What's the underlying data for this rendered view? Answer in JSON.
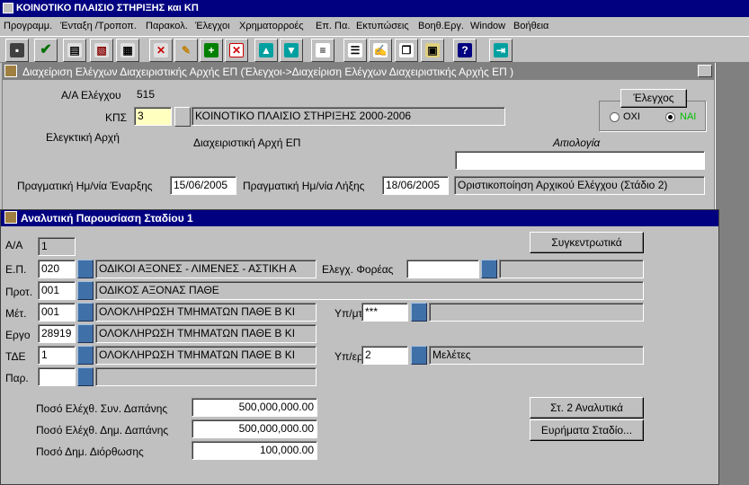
{
  "app": {
    "title": "ΚΟΙΝΟΤΙΚΟ ΠΛΑΙΣΙΟ ΣΤΗΡΙΞΗΣ και ΚΠ"
  },
  "menu": [
    "Προγραμμ.",
    "Ένταξη /Τροποπ.",
    "Παρακολ.",
    "Έλεγχοι",
    "Χρηματορροές",
    "Επ. Πα.",
    "Εκτυπώσεις",
    "Βοηθ.Εργ.",
    "Window",
    "Βοήθεια"
  ],
  "toolbar": [
    "save-icon",
    "accept-icon",
    "open-icon",
    "clear-icon",
    "print-icon",
    "delete-record-icon",
    "edit-icon",
    "add-icon",
    "remove-icon",
    "arrow-up-icon",
    "arrow-down-icon",
    "list-icon",
    "list-values-icon",
    "notes-icon",
    "copy-icon",
    "paste-icon",
    "help-icon",
    "exit-icon"
  ],
  "outer": {
    "title": "Διαχείριση Ελέγχων Διαχειριστικής Αρχής ΕΠ (Έλεγχοι->Διαχείριση Ελέγχων Διαχειριστικής Αρχής ΕΠ )",
    "aa_label": "Α/Α Ελέγχου",
    "aa_value": "515",
    "kps_label": "ΚΠΣ",
    "kps_value": "3",
    "kps_desc": "ΚΟΙΝΟΤΙΚΟ ΠΛΑΙΣΙΟ ΣΤΗΡΙΞΗΣ 2000-2006",
    "auditor_label": "Ελεγκτική Αρχή",
    "managing_label": "Διαχειριστική Αρχή ΕΠ",
    "justification_label": "Αιτιολογία",
    "justification_value": "",
    "start_label": "Πραγματική Ημ/νία Έναρξης",
    "start_value": "15/06/2005",
    "end_label": "Πραγματική Ημ/νία Λήξης",
    "end_value": "18/06/2005",
    "stage_value": "Οριστικοποίηση Αρχικού Ελέγχου (Στάδιο 2)",
    "check_button": "Έλεγχος",
    "no_label": "ΟΧΙ",
    "yes_label": "ΝΑΙ"
  },
  "inner": {
    "title": "Αναλυτική Παρουσίαση Σταδίου 1",
    "aa_label": "Α/Α",
    "aa_value": "1",
    "summary_button": "Συγκεντρωτικά",
    "ep_label": "Ε.Π.",
    "ep_code": "020",
    "ep_desc": "ΟΔΙΚΟΙ ΑΞΟΝΕΣ - ΛΙΜΕΝΕΣ - ΑΣΤΙΚΗ Α",
    "body_label": "Ελεγχ. Φορέας",
    "body_value": "",
    "body_desc": "",
    "prot_label": "Προτ.",
    "prot_code": "001",
    "prot_desc": "ΟΔΙΚΟΣ ΑΞΟΝΑΣ ΠΑΘΕ",
    "met_label": "Μέτ.",
    "met_code": "001",
    "met_desc": "ΟΛΟΚΛΗΡΩΣΗ ΤΜΗΜΑΤΩΝ ΠΑΘΕ Β ΚΙ",
    "ypmt_label": "Υπ/μτ",
    "ypmt_value": "***",
    "ypmt_desc": "",
    "ergo_label": "Εργο",
    "ergo_code": "28919",
    "ergo_desc": "ΟΛΟΚΛΗΡΩΣΗ ΤΜΗΜΑΤΩΝ ΠΑΘΕ Β ΚΙ",
    "tde_label": "ΤΔΕ",
    "tde_code": "1",
    "tde_desc": "ΟΛΟΚΛΗΡΩΣΗ ΤΜΗΜΑΤΩΝ ΠΑΘΕ Β ΚΙ",
    "yperg_label": "Υπ/εργ",
    "yperg_value": "2",
    "yperg_desc": "Μελέτες",
    "par_label": "Παρ.",
    "par_value": "",
    "par_desc": "",
    "amt1_label": "Ποσό Ελέχθ. Συν. Δαπάνης",
    "amt1_value": "500,000,000.00",
    "amt2_label": "Ποσό Ελέχθ. Δημ. Δαπάνης",
    "amt2_value": "500,000,000.00",
    "amt3_label": "Ποσό Δημ. Διόρθωσης",
    "amt3_value": "100,000.00",
    "stage2_button": "Στ. 2 Αναλυτικά",
    "findings_button": "Ευρήματα Σταδίο..."
  }
}
